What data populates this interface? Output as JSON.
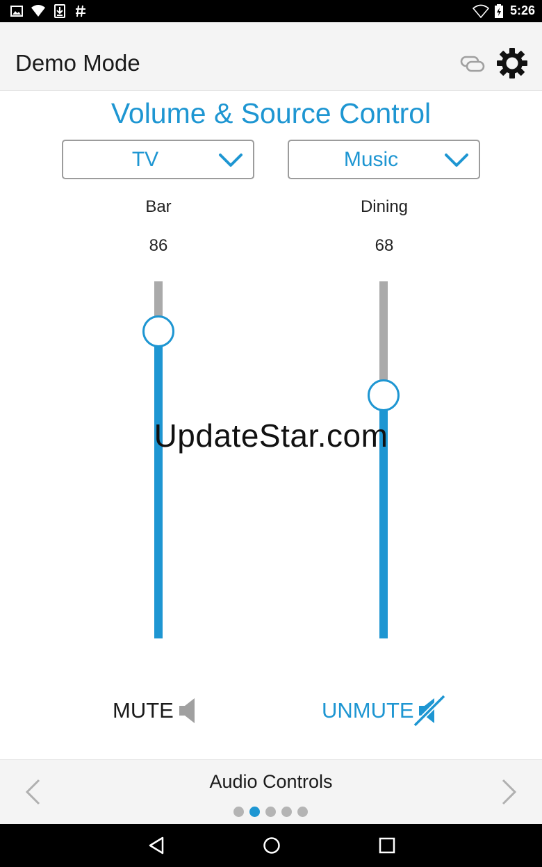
{
  "status_bar": {
    "time": "5:26",
    "icons": [
      "image-icon",
      "wifi-question-icon",
      "download-icon",
      "hash-icon",
      "wifi-icon",
      "battery-charging-icon"
    ]
  },
  "app_bar": {
    "title": "Demo Mode",
    "icons": [
      "link-icon",
      "gear-icon"
    ]
  },
  "main": {
    "title": "Volume & Source Control",
    "zones": [
      {
        "source": "TV",
        "name": "Bar",
        "volume": "86",
        "level": 0.86,
        "mute_label": "MUTE",
        "mute_state": "unmuted",
        "speaker_icon": "speaker-icon"
      },
      {
        "source": "Music",
        "name": "Dining",
        "volume": "68",
        "level": 0.68,
        "mute_label": "UNMUTE",
        "mute_state": "muted",
        "speaker_icon": "speaker-muted-icon"
      }
    ]
  },
  "watermark": "UpdateStar.com",
  "footer": {
    "title": "Audio Controls",
    "page_count": 5,
    "active_page": 2
  },
  "colors": {
    "accent": "#1e96d2",
    "track": "#aaaaaa",
    "muted_gray": "#a0a0a0",
    "bar_bg": "#f4f4f4"
  }
}
